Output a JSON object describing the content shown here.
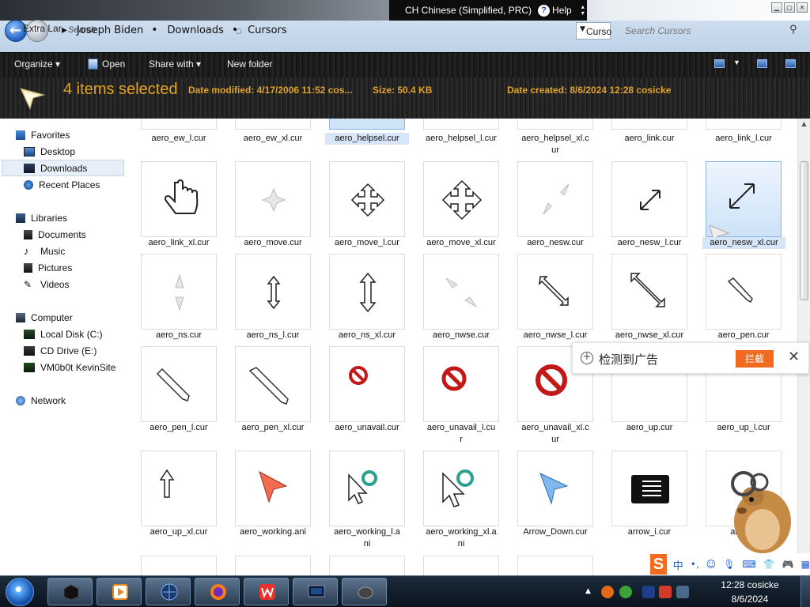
{
  "window": {
    "extra_label": "Extra Lar",
    "breadcrumb": [
      "Joseph Biden",
      "Downloads",
      "Cursors"
    ],
    "ghost_search": "Search",
    "addr_drop_text": "Curso",
    "search_placeholder": "Search Cursors"
  },
  "langbar": {
    "language": "CH Chinese (Simplified, PRC)",
    "help": "Help"
  },
  "toolbar": {
    "organize": "Organize",
    "open": "Open",
    "share_with": "Share with",
    "new_folder": "New folder"
  },
  "details": {
    "selected": "4 items selected",
    "date_modified": "Date modified: 4/17/2006 11:52 cos...",
    "size": "Size: 50.4 KB",
    "date_created": "Date created: 8/6/2024 12:28 cosicke"
  },
  "nav": {
    "favorites": "Favorites",
    "desktop": "Desktop",
    "downloads": "Downloads",
    "recent": "Recent Places",
    "libraries": "Libraries",
    "documents": "Documents",
    "music": "Music",
    "pictures": "Pictures",
    "videos": "Videos",
    "computer": "Computer",
    "local_disk": "Local Disk (C:)",
    "cd_drive": "CD Drive (E:)",
    "vm": "VM0b0t KevinSite",
    "network": "Network"
  },
  "files": {
    "row0": [
      "aero_ew_l.cur",
      "aero_ew_xl.cur",
      "aero_helpsel.cur",
      "aero_helpsel_l.cur",
      "aero_helpsel_xl.c",
      "aero_link.cur",
      "aero_link_l.cur"
    ],
    "row0_wrap": "ur",
    "row1": [
      "aero_link_xl.cur",
      "aero_move.cur",
      "aero_move_l.cur",
      "aero_move_xl.cur",
      "aero_nesw.cur",
      "aero_nesw_l.cur",
      "aero_nesw_xl.cur"
    ],
    "row2": [
      "aero_ns.cur",
      "aero_ns_l.cur",
      "aero_ns_xl.cur",
      "aero_nwse.cur",
      "aero_nwse_l.cur",
      "aero_nwse_xl.cur",
      "aero_pen.cur"
    ],
    "row3": [
      "aero_pen_l.cur",
      "aero_pen_xl.cur",
      "aero_unavail.cur",
      "aero_unavail_l.cu",
      "aero_unavail_xl.c",
      "aero_up.cur",
      "aero_up_l.cur"
    ],
    "row3_wrap": [
      "r",
      "ur"
    ],
    "row4": [
      "aero_up_xl.cur",
      "aero_working.ani",
      "aero_working_l.a",
      "aero_working_xl.a",
      "Arrow_Down.cur",
      "arrow_i.cur",
      "arrow_"
    ],
    "row4_wrap": [
      "ni",
      "ni"
    ]
  },
  "popup": {
    "text": "检测到广告",
    "button": "拦截"
  },
  "clock": {
    "time": "12:28 cosicke",
    "date": "8/6/2024"
  },
  "ime": {
    "logo": "S",
    "mode": "中"
  },
  "icons": {
    "back": "back-arrow-icon",
    "forward": "forward-arrow-icon",
    "search": "search-icon",
    "help": "help-icon",
    "open": "open-icon",
    "folder_star": "favorites-star-icon",
    "library": "library-icon",
    "computer": "computer-icon",
    "network": "network-icon",
    "start": "windows-start-icon"
  },
  "colors": {
    "accent": "#e3a11e",
    "selection": "#cde2f8",
    "popup_button": "#f06a20"
  }
}
